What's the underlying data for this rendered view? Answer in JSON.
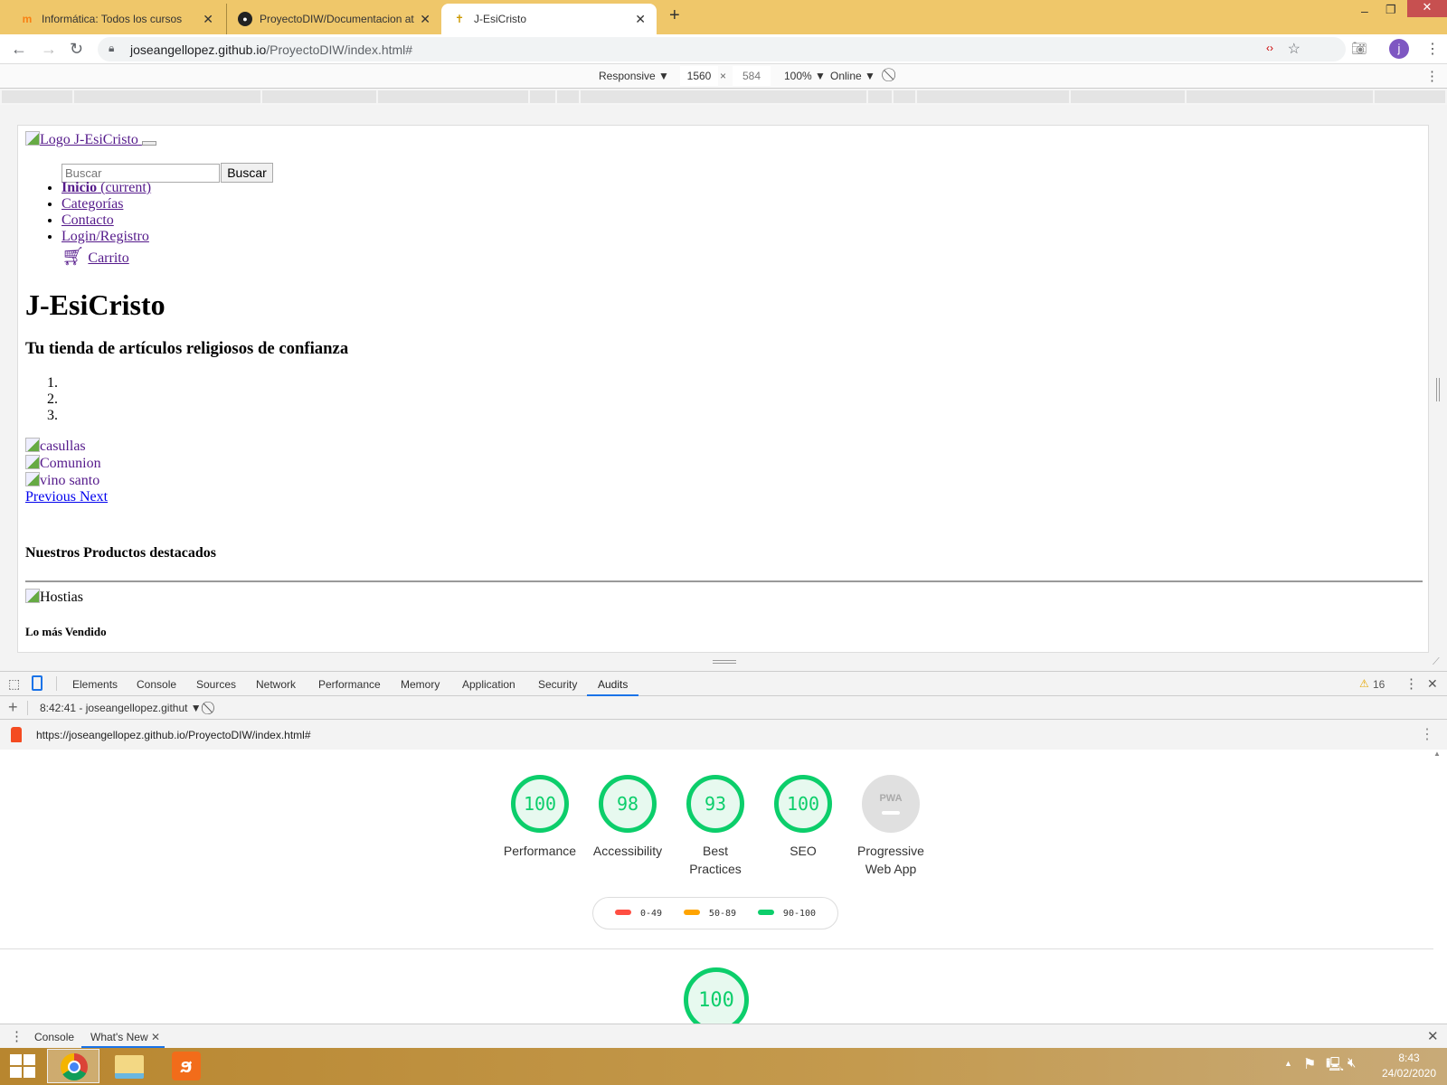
{
  "browser": {
    "tabs": [
      {
        "title": "Informática: Todos los cursos",
        "icon": "moodle-icon"
      },
      {
        "title": "ProyectoDIW/Documentacion at",
        "icon": "github-icon"
      },
      {
        "title": "J-EsiCristo",
        "icon": "site-favicon",
        "active": true
      }
    ],
    "url_host": "joseangellopez.github.io",
    "url_path": "/ProyectoDIW/index.html#",
    "profile_initial": "j"
  },
  "device_toolbar": {
    "mode": "Responsive",
    "width": "1560",
    "times": "×",
    "height": "584",
    "zoom": "100%",
    "network": "Online"
  },
  "page": {
    "logo_alt": "Logo J-EsiCristo",
    "search_placeholder": "Buscar",
    "search_button": "Buscar",
    "nav": [
      {
        "label": "Inicio",
        "extra": "(current)"
      },
      {
        "label": "Categorías"
      },
      {
        "label": "Contacto"
      },
      {
        "label": "Login/Registro"
      }
    ],
    "cart": "Carrito",
    "title": "J-EsiCristo",
    "subtitle": "Tu tienda de artículos religiosos de confianza",
    "indicators": [
      "1.",
      "2.",
      "3."
    ],
    "carousel": [
      "casullas",
      "Comunion",
      "vino santo"
    ],
    "prev_next": "Previous Next",
    "featured": "Nuestros Productos destacados",
    "product": "Hostias",
    "best_seller": "Lo más Vendido"
  },
  "devtools": {
    "tabs": [
      "Elements",
      "Console",
      "Sources",
      "Network",
      "Performance",
      "Memory",
      "Application",
      "Security",
      "Audits"
    ],
    "active_tab": "Audits",
    "warnings": "16",
    "report_select": "8:42:41 - joseangellopez.githut",
    "report_url": "https://joseangellopez.github.io/ProyectoDIW/index.html#",
    "scores": [
      {
        "label": "Performance",
        "value": "100"
      },
      {
        "label": "Accessibility",
        "value": "98"
      },
      {
        "label": "Best Practices",
        "value": "93"
      },
      {
        "label": "SEO",
        "value": "100"
      }
    ],
    "pwa": {
      "label": "Progressive Web App",
      "badge": "PWA"
    },
    "legend": [
      {
        "range": "0-49",
        "color": "#ff4e42"
      },
      {
        "range": "50-89",
        "color": "#ffa400"
      },
      {
        "range": "90-100",
        "color": "#0cce6b"
      }
    ],
    "section_score": "100",
    "drawer_tabs": [
      "Console",
      "What's New"
    ]
  },
  "taskbar": {
    "time": "8:43",
    "date": "24/02/2020"
  }
}
